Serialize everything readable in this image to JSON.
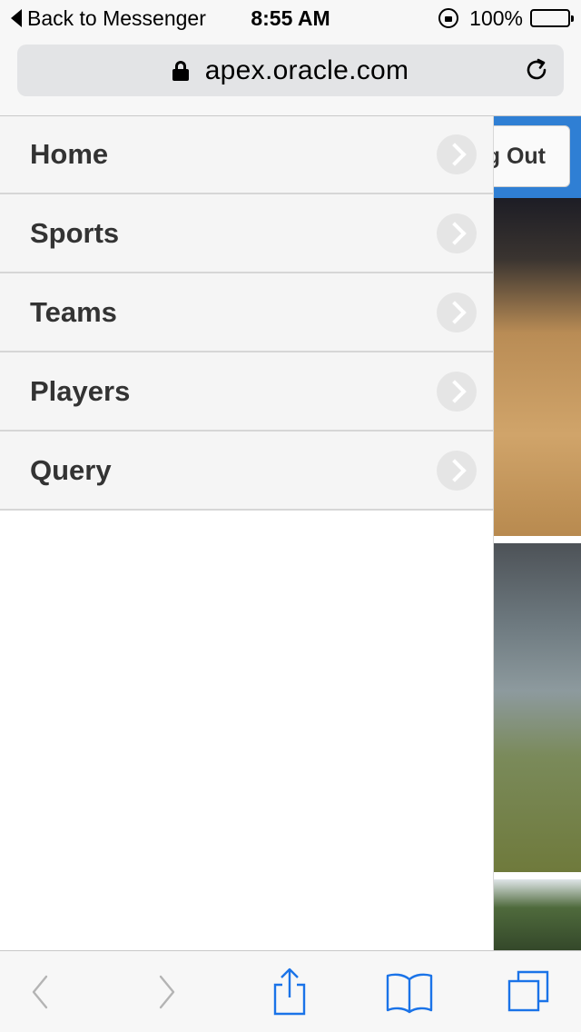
{
  "status_bar": {
    "back_label": "Back to Messenger",
    "time": "8:55 AM",
    "battery": "100%",
    "icons": [
      "back-triangle-icon",
      "rotation-lock-icon",
      "battery-icon"
    ]
  },
  "url_bar": {
    "url": "apex.oracle.com",
    "icons": [
      "padlock-icon",
      "reload-icon"
    ]
  },
  "header": {
    "sign_out_partial": "g Out"
  },
  "menu": {
    "items": [
      {
        "label": "Home"
      },
      {
        "label": "Sports"
      },
      {
        "label": "Teams"
      },
      {
        "label": "Players"
      },
      {
        "label": "Query"
      }
    ]
  },
  "toolbar": {
    "icons": [
      "back-arrow-icon",
      "forward-arrow-icon",
      "share-icon",
      "bookmarks-icon",
      "tabs-icon"
    ]
  },
  "colors": {
    "accent": "#2f7fd4",
    "toolbar_active": "#1a73e8",
    "toolbar_disabled": "#b4b4b4",
    "menu_text": "#333333"
  }
}
